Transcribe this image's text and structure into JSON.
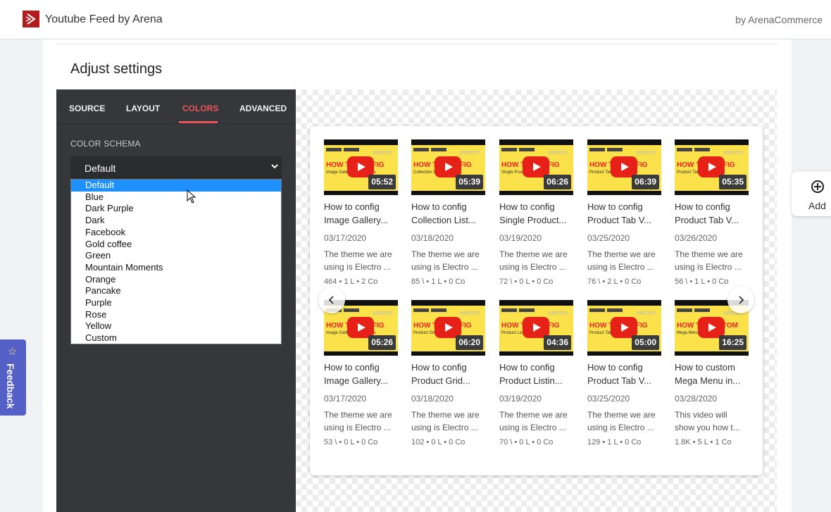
{
  "header": {
    "app_title": "Youtube Feed by Arena",
    "vendor": "by ArenaCommerce",
    "brand_color": "#b31d1d"
  },
  "page": {
    "title": "Adjust settings"
  },
  "tabs": [
    {
      "label": "SOURCE",
      "active": false
    },
    {
      "label": "LAYOUT",
      "active": false
    },
    {
      "label": "COLORS",
      "active": true
    },
    {
      "label": "ADVANCED",
      "active": false
    }
  ],
  "color_schema": {
    "label": "COLOR SCHEMA",
    "selected": "Default",
    "options": [
      "Default",
      "Blue",
      "Dark Purple",
      "Dark",
      "Facebook",
      "Gold coffee",
      "Green",
      "Mountain Moments",
      "Orange",
      "Pancake",
      "Purple",
      "Rose",
      "Yellow",
      "Custom"
    ]
  },
  "accent_color": "#e8545a",
  "videos": [
    {
      "title1": "How to config",
      "title2": "Image Gallery...",
      "date": "03/17/2020",
      "desc1": "The theme we are",
      "desc2": "using is Electro ...",
      "stats": "464  •  1 L  •  2 Co",
      "duration": "05:52",
      "thumb_headline": "HOW TO CONFIG",
      "thumb_sub": "Image Gallery for Sections"
    },
    {
      "title1": "How to config",
      "title2": "Collection List...",
      "date": "03/18/2020",
      "desc1": "The theme we are",
      "desc2": "using is Electro ...",
      "stats": "85 \\  •  1 L  •  0 Co",
      "duration": "05:39",
      "thumb_headline": "HOW TO CONFIG",
      "thumb_sub": "Collection List Sections"
    },
    {
      "title1": "How to config",
      "title2": "Single Product...",
      "date": "03/19/2020",
      "desc1": "The theme we are",
      "desc2": "using is Electro ...",
      "stats": "72 \\  •  0 L  •  0 Co",
      "duration": "06:26",
      "thumb_headline": "HOW TO CONFIG",
      "thumb_sub": "Single Product Sections"
    },
    {
      "title1": "How to config",
      "title2": "Product Tab V...",
      "date": "03/25/2020",
      "desc1": "The theme we are",
      "desc2": "using is Electro ...",
      "stats": "76 \\  •  2 L  •  0 Co",
      "duration": "06:39",
      "thumb_headline": "HOW TO CONFIG",
      "thumb_sub": "Product Tab Vertical"
    },
    {
      "title1": "How to config",
      "title2": "Product Tab V...",
      "date": "03/26/2020",
      "desc1": "The theme we are",
      "desc2": "using is Electro ...",
      "stats": "56 \\  •  1 L  •  0 Co",
      "duration": "05:35",
      "thumb_headline": "HOW TO CONFIG",
      "thumb_sub": "Product Tab Vertical"
    },
    {
      "title1": "How to config",
      "title2": "Image Gallery...",
      "date": "03/17/2020",
      "desc1": "The theme we are",
      "desc2": "using is Electro ...",
      "stats": "53 \\  •  0 L  •  0 Co",
      "duration": "05:26",
      "thumb_headline": "HOW TO CONFIG",
      "thumb_sub": "Image Gallery for Sections"
    },
    {
      "title1": "How to config",
      "title2": "Product Grid...",
      "date": "03/18/2020",
      "desc1": "The theme we are",
      "desc2": "using is Electro ...",
      "stats": "102  •  0 L  •  0 Co",
      "duration": "06:20",
      "thumb_headline": "HOW TO CONFIG",
      "thumb_sub": "Product Grid Sections"
    },
    {
      "title1": "How to config",
      "title2": "Product Listin...",
      "date": "03/19/2020",
      "desc1": "The theme we are",
      "desc2": "using is Electro ...",
      "stats": "70 \\  •  0 L  •  0 Co",
      "duration": "04:36",
      "thumb_headline": "HOW TO CONFIG",
      "thumb_sub": "Product Listing Sections"
    },
    {
      "title1": "How to config",
      "title2": "Product Tab V...",
      "date": "03/25/2020",
      "desc1": "The theme we are",
      "desc2": "using is Electro ...",
      "stats": "129  •  1 L  •  0 Co",
      "duration": "05:00",
      "thumb_headline": "HOW TO CONFIG",
      "thumb_sub": "Product Tab Vertical"
    },
    {
      "title1": "How to custom",
      "title2": "Mega Menu in...",
      "date": "03/28/2020",
      "desc1": "This video will",
      "desc2": "show you how t...",
      "stats": "1.8K  •  5 L  •  1 Co",
      "duration": "16:25",
      "thumb_headline": "HOW TO CUSTOM",
      "thumb_sub": "Mega Menu in Electro"
    }
  ],
  "add_button": {
    "label": "Add"
  },
  "feedback": {
    "label": "Feedback"
  }
}
